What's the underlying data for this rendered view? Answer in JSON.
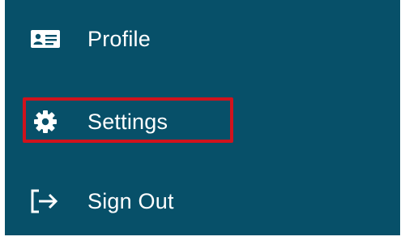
{
  "menu": {
    "items": [
      {
        "id": "profile",
        "label": "Profile",
        "icon": "profile-card-icon"
      },
      {
        "id": "settings",
        "label": "Settings",
        "icon": "gear-icon"
      },
      {
        "id": "signout",
        "label": "Sign Out",
        "icon": "sign-out-icon"
      }
    ],
    "highlighted_item": "settings"
  },
  "colors": {
    "background": "#075069",
    "text": "#ffffff",
    "highlight": "#d0131d"
  }
}
